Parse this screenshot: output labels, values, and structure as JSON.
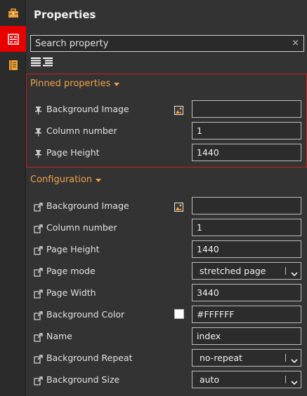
{
  "panel": {
    "title": "Properties"
  },
  "search": {
    "placeholder": "Search property",
    "clear_glyph": "×"
  },
  "rail": {
    "items": [
      {
        "icon": "toolbox-icon",
        "active": false
      },
      {
        "icon": "properties-icon",
        "active": true,
        "accent": "#e60000"
      },
      {
        "icon": "notes-icon",
        "active": false
      }
    ]
  },
  "pinned": {
    "label": "Pinned properties",
    "border_color": "#cc1f1f",
    "rows": [
      {
        "label": "Background Image",
        "value": "",
        "type": "image"
      },
      {
        "label": "Column number",
        "value": "1",
        "type": "text"
      },
      {
        "label": "Page Height",
        "value": "1440",
        "type": "text"
      }
    ]
  },
  "configuration": {
    "label": "Configuration",
    "rows": [
      {
        "label": "Background Image",
        "value": "",
        "type": "image"
      },
      {
        "label": "Column number",
        "value": "1",
        "type": "text"
      },
      {
        "label": "Page Height",
        "value": "1440",
        "type": "text"
      },
      {
        "label": "Page mode",
        "value": "stretched page",
        "type": "select"
      },
      {
        "label": "Page Width",
        "value": "3440",
        "type": "text"
      },
      {
        "label": "Background Color",
        "value": "#FFFFFF",
        "type": "color",
        "swatch": "#FFFFFF"
      },
      {
        "label": "Name",
        "value": "index",
        "type": "text"
      },
      {
        "label": "Background Repeat",
        "value": "no-repeat",
        "type": "select"
      },
      {
        "label": "Background Size",
        "value": "auto",
        "type": "select"
      }
    ]
  },
  "colors": {
    "section_heading": "#f0a24a",
    "background": "#333333"
  }
}
